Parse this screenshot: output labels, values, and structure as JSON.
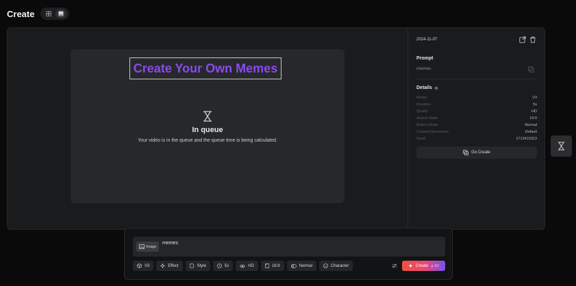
{
  "header": {
    "title": "Create"
  },
  "preview": {
    "meme_title": "Create Your Own Memes",
    "status_title": "In queue",
    "status_desc": "Your video is in the queue and the queue time is being calculated."
  },
  "details_panel": {
    "date": "2024-11-07",
    "prompt_label": "Prompt",
    "prompt_text": "memes",
    "details_label": "Details",
    "rows": [
      {
        "key": "Model",
        "value": "V3"
      },
      {
        "key": "Duration",
        "value": "5s"
      },
      {
        "key": "Quality",
        "value": "HD"
      },
      {
        "key": "Aspect Ratio",
        "value": "16:9"
      },
      {
        "key": "Motion Mode",
        "value": "Normal"
      },
      {
        "key": "Camera Movement",
        "value": "Default"
      },
      {
        "key": "Seed",
        "value": "1713419313"
      }
    ],
    "go_create_label": "Go Create"
  },
  "composer": {
    "image_chip_label": "Image",
    "prompt_text": "memes",
    "toolbar": {
      "model": "V3",
      "effect": "Effect",
      "style": "Style",
      "duration": "5s",
      "quality": "HD",
      "ratio": "16:9",
      "motion": "Normal",
      "character": "Character"
    },
    "create_label": "Create",
    "credits": "30"
  },
  "colors": {
    "accent_purple": "#8a4bea",
    "create_gradient_start": "#f0503f",
    "create_gradient_end": "#7a4ff0"
  }
}
